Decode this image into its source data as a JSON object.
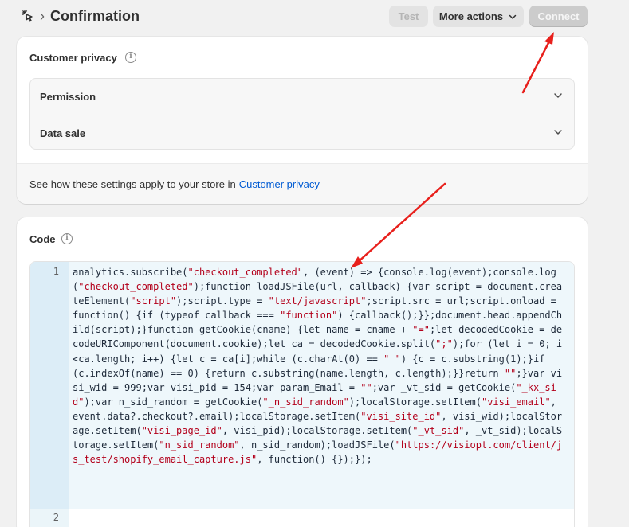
{
  "header": {
    "title": "Confirmation",
    "buttons": {
      "test": "Test",
      "more_actions": "More actions",
      "connect": "Connect"
    }
  },
  "privacy": {
    "title": "Customer privacy",
    "rows": [
      {
        "label": "Permission"
      },
      {
        "label": "Data sale"
      }
    ],
    "footer_text": "See how these settings apply to your store in",
    "footer_link": "Customer privacy"
  },
  "code": {
    "title": "Code",
    "line_numbers": [
      "1",
      "2"
    ],
    "source": "analytics.subscribe(\"checkout_completed\", (event) => {console.log(event);console.log(\"checkout_completed\");function loadJSFile(url, callback) {var script = document.createElement(\"script\");script.type = \"text/javascript\";script.src = url;script.onload = function() {if (typeof callback === \"function\") {callback();}};document.head.appendChild(script);}function getCookie(cname) {let name = cname + \"=\";let decodedCookie = decodeURIComponent(document.cookie);let ca = decodedCookie.split(\";\");for (let i = 0; i <ca.length; i++) {let c = ca[i];while (c.charAt(0) == \" \") {c = c.substring(1);}if (c.indexOf(name) == 0) {return c.substring(name.length, c.length);}}return \"\";}var visi_wid = 999;var visi_pid = 154;var param_Email = \"\";var _vt_sid = getCookie(\"_kx_sid\");var n_sid_random = getCookie(\"_n_sid_random\");localStorage.setItem(\"visi_email\", event.data?.checkout?.email);localStorage.setItem(\"visi_site_id\", visi_wid);localStorage.setItem(\"visi_page_id\", visi_pid);localStorage.setItem(\"_vt_sid\", _vt_sid);localStorage.setItem(\"n_sid_random\", n_sid_random);loadJSFile(\"https://visiopt.com/client/js_test/shopify_email_capture.js\", function() {});});"
  },
  "colors": {
    "primary_link": "#005bd3",
    "annotation_arrow": "#e8201c",
    "string_token": "#b3001b"
  },
  "icons": [
    "pointer-click-icon",
    "chevron-right-icon",
    "chevron-down-icon",
    "info-icon"
  ]
}
